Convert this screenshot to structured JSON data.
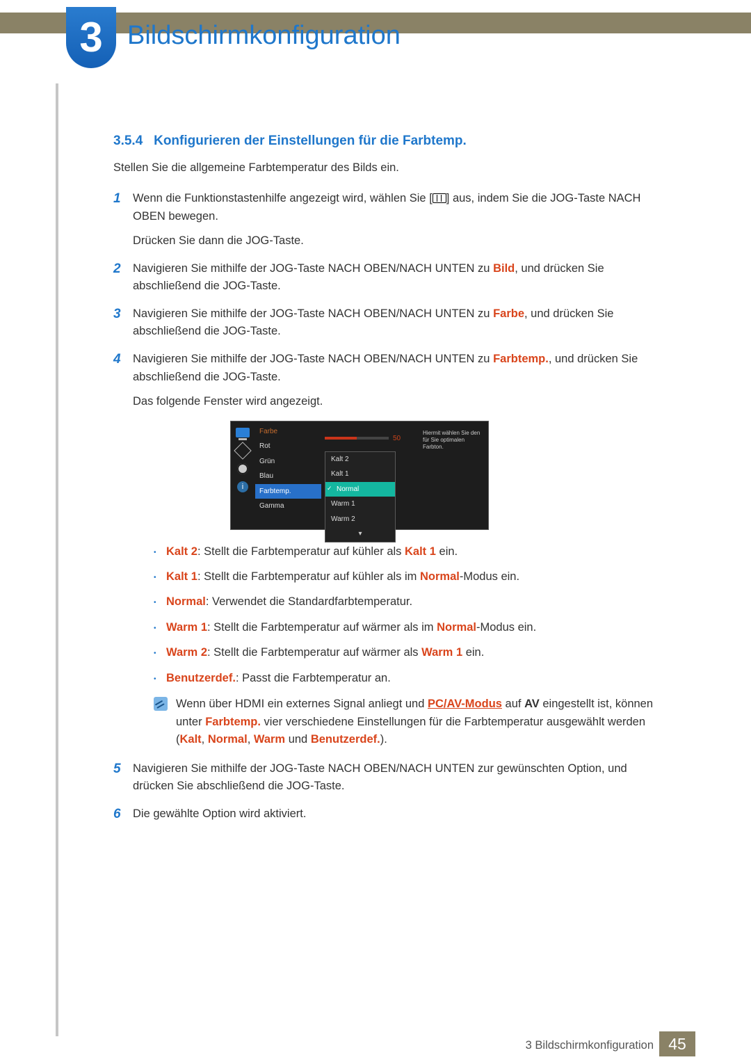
{
  "chapter": {
    "number": "3",
    "title": "Bildschirmkonfiguration"
  },
  "section": {
    "number": "3.5.4",
    "title": "Konfigurieren der Einstellungen für die Farbtemp."
  },
  "intro": "Stellen Sie die allgemeine Farbtemperatur des Bilds ein.",
  "steps": {
    "1": {
      "pre": "Wenn die Funktionstastenhilfe angezeigt wird, wählen Sie [",
      "post": "] aus, indem Sie die JOG-Taste NACH OBEN bewegen.",
      "sub": "Drücken Sie dann die JOG-Taste."
    },
    "2": {
      "pre": "Navigieren Sie mithilfe der JOG-Taste NACH OBEN/NACH UNTEN zu ",
      "kw": "Bild",
      "post": ", und drücken Sie abschließend die JOG-Taste."
    },
    "3": {
      "pre": "Navigieren Sie mithilfe der JOG-Taste NACH OBEN/NACH UNTEN zu ",
      "kw": "Farbe",
      "post": ", und drücken Sie abschließend die JOG-Taste."
    },
    "4": {
      "pre": "Navigieren Sie mithilfe der JOG-Taste NACH OBEN/NACH UNTEN zu ",
      "kw": "Farbtemp.",
      "post": ", und drücken Sie abschließend die JOG-Taste.",
      "sub": "Das folgende Fenster wird angezeigt."
    },
    "5": "Navigieren Sie mithilfe der JOG-Taste NACH OBEN/NACH UNTEN zur gewünschten Option, und drücken Sie abschließend die JOG-Taste.",
    "6": "Die gewählte Option wird aktiviert."
  },
  "osd": {
    "title": "Farbe",
    "items": [
      "Rot",
      "Grün",
      "Blau",
      "Farbtemp.",
      "Gamma"
    ],
    "selected_item_index": 3,
    "slider_value": "50",
    "slider_percent": 50,
    "popup": [
      "Kalt 2",
      "Kalt 1",
      "Normal",
      "Warm 1",
      "Warm 2"
    ],
    "popup_selected_index": 2,
    "hint": "Hiermit wählen Sie den für Sie optimalen Farbton.",
    "info_glyph": "i"
  },
  "bullets": {
    "0": {
      "kwA": "Kalt 2",
      "mid": ": Stellt die Farbtemperatur auf kühler als ",
      "kwB": "Kalt 1",
      "post": " ein."
    },
    "1": {
      "kwA": "Kalt 1",
      "mid": ": Stellt die Farbtemperatur auf kühler als im ",
      "kwB": "Normal",
      "post": "-Modus ein."
    },
    "2": {
      "kwA": "Normal",
      "mid": ": Verwendet die Standardfarbtemperatur.",
      "kwB": "",
      "post": ""
    },
    "3": {
      "kwA": "Warm 1",
      "mid": ": Stellt die Farbtemperatur auf wärmer als im ",
      "kwB": "Normal",
      "post": "-Modus ein."
    },
    "4": {
      "kwA": "Warm 2",
      "mid": ": Stellt die Farbtemperatur auf wärmer als ",
      "kwB": "Warm 1",
      "post": " ein."
    },
    "5": {
      "kwA": "Benutzerdef.",
      "mid": ": Passt die Farbtemperatur an.",
      "kwB": "",
      "post": ""
    }
  },
  "note": {
    "t1": "Wenn über HDMI ein externes Signal anliegt und ",
    "link": "PC/AV-Modus",
    "t2": " auf ",
    "kwAV": "AV",
    "t3": " eingestellt ist, können unter ",
    "kwFT": "Farbtemp.",
    "t4": " vier verschiedene Einstellungen für die Farbtemperatur ausgewählt werden (",
    "kwKalt": "Kalt",
    "comma1": ", ",
    "kwNormal": "Normal",
    "comma2": ", ",
    "kwWarm": "Warm",
    "t5": " und ",
    "kwBen": "Benutzerdef.",
    "t6": ")."
  },
  "footer": {
    "text": "3 Bildschirmkonfiguration",
    "page": "45"
  }
}
